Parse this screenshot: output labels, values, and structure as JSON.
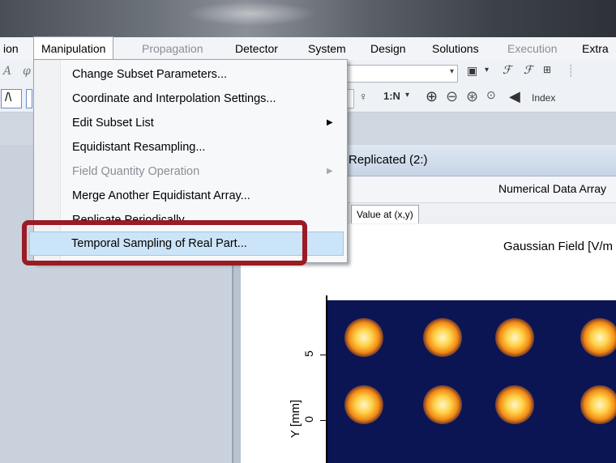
{
  "menubar": {
    "items": [
      {
        "label": "ion",
        "state": "normal"
      },
      {
        "label": "Manipulation",
        "state": "active"
      },
      {
        "label": "Propagation",
        "state": "disabled"
      },
      {
        "label": "Detector",
        "state": "normal"
      },
      {
        "label": "System",
        "state": "normal"
      },
      {
        "label": "Design",
        "state": "normal"
      },
      {
        "label": "Solutions",
        "state": "normal"
      },
      {
        "label": "Execution",
        "state": "disabled"
      },
      {
        "label": "Extra",
        "state": "normal"
      }
    ]
  },
  "dropdown": {
    "items": [
      {
        "label": "Change Subset Parameters...",
        "disabled": false,
        "submenu": false
      },
      {
        "label": "Coordinate and Interpolation Settings...",
        "disabled": false,
        "submenu": false
      },
      {
        "label": "Edit Subset List",
        "disabled": false,
        "submenu": true
      },
      {
        "label": "Equidistant Resampling...",
        "disabled": false,
        "submenu": false
      },
      {
        "label": "Field Quantity Operation",
        "disabled": true,
        "submenu": true
      },
      {
        "label": "Merge Another Equidistant Array...",
        "disabled": false,
        "submenu": false
      },
      {
        "label": "Replicate Periodically...",
        "disabled": false,
        "submenu": false
      },
      {
        "label": "Temporal Sampling of Real Part...",
        "disabled": false,
        "submenu": false,
        "highlighted": true
      }
    ]
  },
  "toolbar": {
    "index_label": "Index",
    "one_n_label": "1:N"
  },
  "document": {
    "title": "Replicated (2:)",
    "subtitle": "Numerical Data Array",
    "tab_label": "Value at (x,y)",
    "plot_label": "Gaussian Field  [V/m",
    "y_axis_label": "Y [mm]",
    "y_ticks": [
      "5",
      "0"
    ]
  },
  "colors": {
    "highlight": "#cce4f7",
    "annotation": "#9b1b24",
    "plot_background": "#0b1554"
  }
}
